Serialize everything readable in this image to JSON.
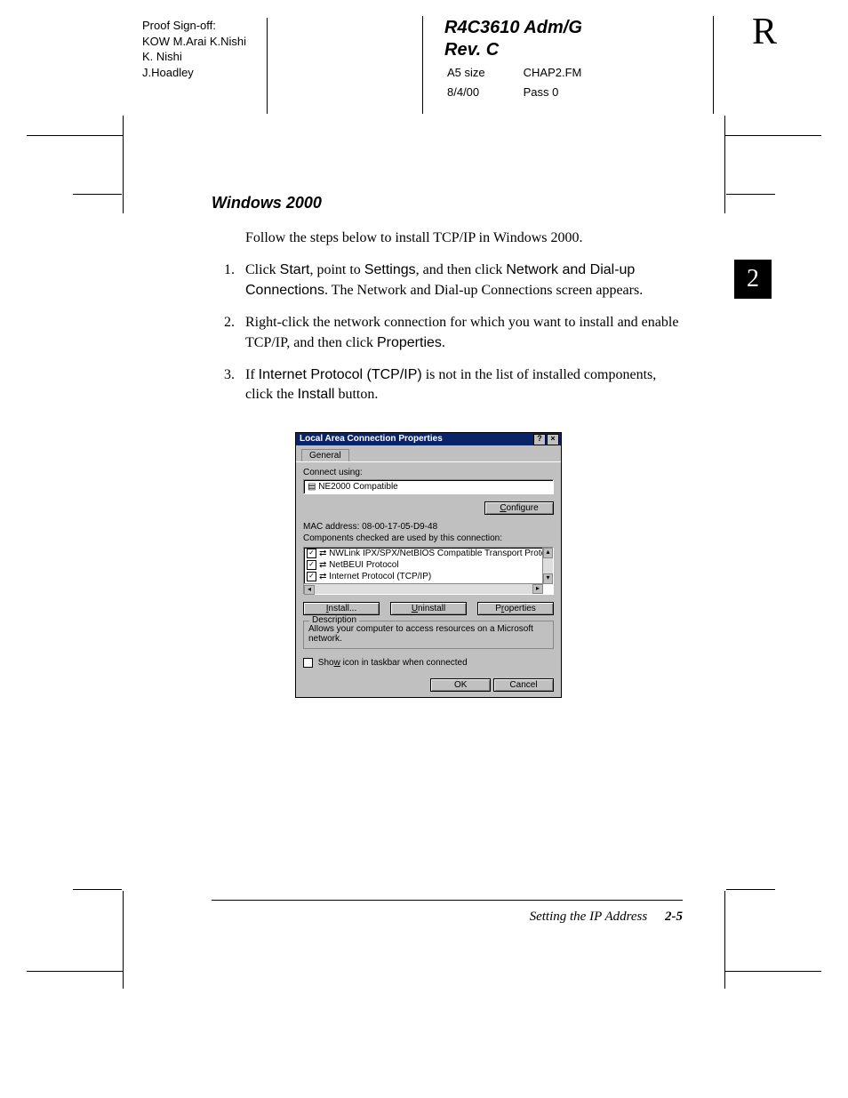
{
  "header": {
    "proof_title": "Proof Sign-off:",
    "proof_lines": [
      "KOW M.Arai  K.Nishi",
      "K. Nishi",
      "J.Hoadley"
    ],
    "doc_id": "R4C3610  Adm/G",
    "rev": "Rev. C",
    "size": "A5 size",
    "file": "CHAP2.FM",
    "date": "8/4/00",
    "pass": "Pass 0",
    "big_r": "R"
  },
  "chapter_badge": "2",
  "section": {
    "heading": "Windows 2000",
    "intro": "Follow the steps below to install TCP/IP in Windows 2000.",
    "steps": [
      {
        "pre": "Click ",
        "t1": "Start",
        "mid1": ", point to ",
        "t2": "Settings",
        "mid2": ", and then click ",
        "t3": "Network and Dial-up Connections",
        "post": ". The Network and Dial-up Connections screen appears."
      },
      {
        "pre": "Right-click the network connection for which you want to install and enable TCP/IP, and then click ",
        "t1": "Properties",
        "post": "."
      },
      {
        "pre": "If ",
        "t1": "Internet Protocol (TCP/IP)",
        "mid1": " is not in the list of installed components, click the ",
        "t2": "Install",
        "post": " button."
      }
    ]
  },
  "dialog": {
    "title": "Local Area Connection Properties",
    "tab": "General",
    "connect_using_label": "Connect using:",
    "adapter": "NE2000 Compatible",
    "configure_btn": "Configure",
    "mac_label": "MAC address:  08-00-17-05-D9-48",
    "components_label": "Components checked are used by this connection:",
    "components": [
      "NWLink IPX/SPX/NetBIOS Compatible Transport Proto",
      "NetBEUI Protocol",
      "Internet Protocol (TCP/IP)"
    ],
    "install_btn": "Install...",
    "uninstall_btn": "Uninstall",
    "properties_btn": "Properties",
    "desc_label": "Description",
    "desc_text": "Allows your computer to access resources on a Microsoft network.",
    "show_icon": "Show icon in taskbar when connected",
    "ok": "OK",
    "cancel": "Cancel"
  },
  "footer": {
    "title": "Setting the IP Address",
    "page": "2-5"
  }
}
